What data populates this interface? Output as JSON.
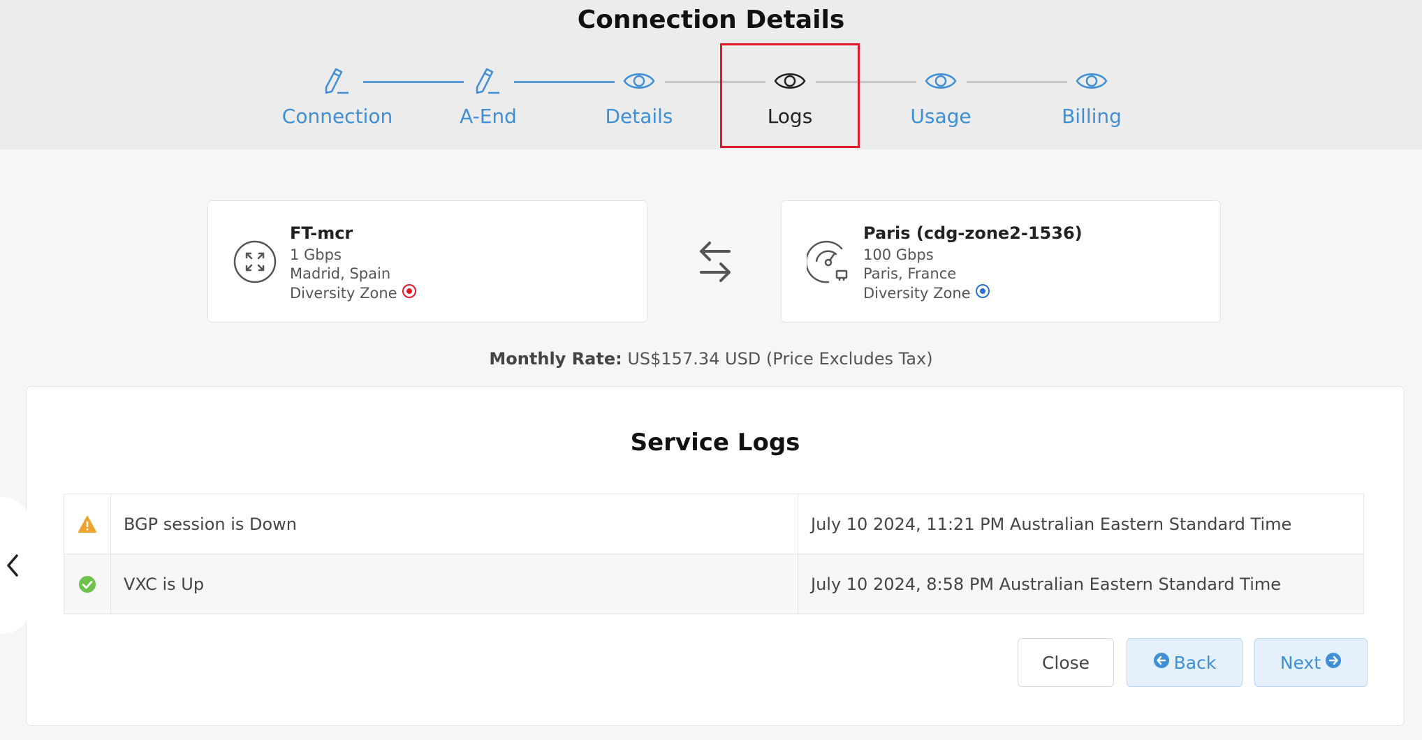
{
  "page": {
    "title": "Connection Details"
  },
  "stepper": {
    "steps": [
      {
        "label": "Connection",
        "icon": "pencil-icon",
        "state": "done"
      },
      {
        "label": "A-End",
        "icon": "pencil-icon",
        "state": "done"
      },
      {
        "label": "Details",
        "icon": "eye-icon",
        "state": "done"
      },
      {
        "label": "Logs",
        "icon": "eye-icon",
        "state": "active"
      },
      {
        "label": "Usage",
        "icon": "eye-icon",
        "state": "todo"
      },
      {
        "label": "Billing",
        "icon": "eye-icon",
        "state": "todo"
      }
    ]
  },
  "a_end": {
    "icon": "mcr-router-icon",
    "name": "FT-mcr",
    "speed": "1 Gbps",
    "location": "Madrid, Spain",
    "diversity_label": "Diversity Zone",
    "diversity_color": "#e0192b"
  },
  "b_end": {
    "icon": "speedometer-port-icon",
    "name": "Paris (cdg-zone2-1536)",
    "speed": "100 Gbps",
    "location": "Paris, France",
    "diversity_label": "Diversity Zone",
    "diversity_color": "#2b6fd1"
  },
  "swap_icon": "swap-arrows-icon",
  "rate": {
    "label": "Monthly Rate:",
    "value": "US$157.34 USD (Price Excludes Tax)"
  },
  "service_logs": {
    "title": "Service Logs",
    "rows": [
      {
        "status": "warning",
        "icon": "warning-icon",
        "color": "#f0a32a",
        "message": "BGP session is Down",
        "time": "July 10 2024, 11:21 PM Australian Eastern Standard Time"
      },
      {
        "status": "ok",
        "icon": "check-circle-icon",
        "color": "#6cc24a",
        "message": "VXC is Up",
        "time": "July 10 2024, 8:58 PM Australian Eastern Standard Time"
      }
    ]
  },
  "buttons": {
    "close": "Close",
    "back": "Back",
    "next": "Next"
  },
  "colors": {
    "accent": "#3e8fd6",
    "highlight_border": "#e0192b"
  }
}
